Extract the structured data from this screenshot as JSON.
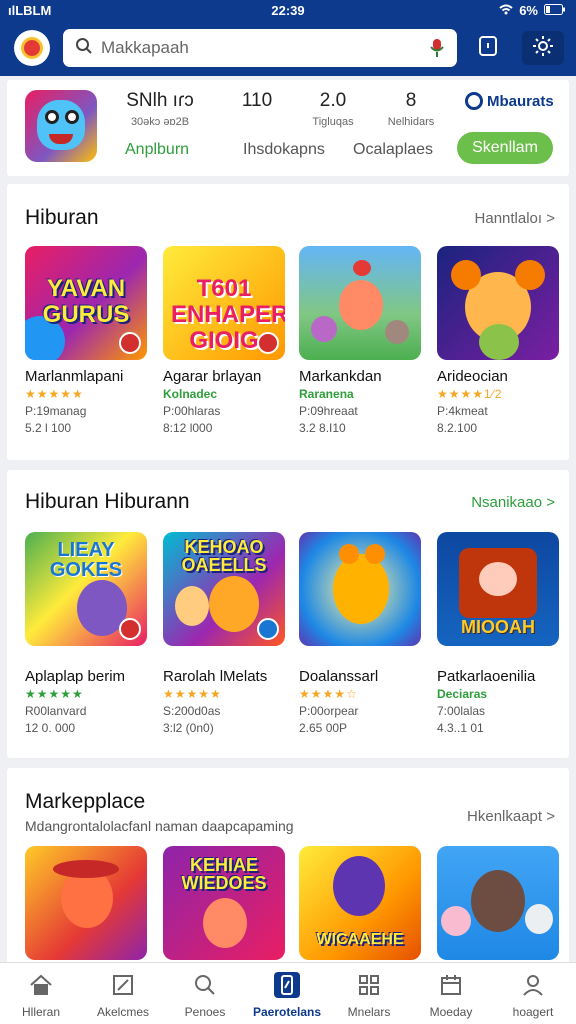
{
  "status_bar": {
    "carrier": "ılLBLM",
    "time": "22:39",
    "battery": "6%"
  },
  "header": {
    "search_placeholder": "Makkapaah",
    "icons": [
      "app-logo",
      "search-icon",
      "mic-icon",
      "save-icon",
      "settings-icon"
    ]
  },
  "top_card": {
    "stats": [
      {
        "value": "SNlh ıɾɔ",
        "label": "30əkɔ əɒ2B"
      },
      {
        "value": "110",
        "label": ""
      },
      {
        "value": "2.0",
        "label": "Tigluqas"
      },
      {
        "value": "8",
        "label": "Nelhidars"
      }
    ],
    "brand": "Mbaurats",
    "links": [
      "Anplburn",
      "Ihsdokapns",
      "Ocalaplaes"
    ],
    "cta": "Skenllam"
  },
  "sections": [
    {
      "title": "Hiburan",
      "subtitle": "",
      "more": "Hanntlaloı >",
      "more_green": false,
      "apps": [
        {
          "name": "Marlanmlapani",
          "art": "YAVAN GURUS",
          "rating": "★★★★★",
          "stat1": "P:19manag",
          "stat2": "5.2 l 100"
        },
        {
          "name": "Agarar brlayan",
          "art": "T601 ENHAPER GIOIG",
          "rating": "Kolnadec",
          "stat1": "P:00hlaras",
          "stat2": "8:12 l000"
        },
        {
          "name": "Markankdan",
          "art": "",
          "rating": "Raranena",
          "stat1": "P:09hreaat",
          "stat2": "3.2 8.I10"
        },
        {
          "name": "Arideocian",
          "art": "",
          "rating": "★★★★1⁄2",
          "stat1": "P:4kmeat",
          "stat2": "8.2.100"
        }
      ]
    },
    {
      "title": "Hiburan Hiburann",
      "subtitle": "",
      "more": "Nsanikaao >",
      "more_green": true,
      "apps": [
        {
          "name": "Aplaplap berim",
          "art": "LIEAY GOKES",
          "rating": "★★★★★",
          "stat1": "R00lanvard",
          "stat2": "12 0. 000"
        },
        {
          "name": "Rarolah lMelats",
          "art": "KEHOAO OAEELLS",
          "rating": "★★★★★",
          "stat1": "S:200d0as",
          "stat2": "3:l2 (0n0)"
        },
        {
          "name": "Doalanssarl",
          "art": "",
          "rating": "★★★★☆",
          "stat1": "P:00orpear",
          "stat2": "2.65 00P"
        },
        {
          "name": "Patkarlaoenilia",
          "art": "MIOOAH",
          "rating": "Deciaras",
          "stat1": "7:00lalas",
          "stat2": "4.3..1 01"
        }
      ]
    },
    {
      "title": "Markepplace",
      "subtitle": "Mdangrontalolacfanl naman daapcapaming",
      "more": "Hkenlkaapt >",
      "more_green": false,
      "apps": [
        {
          "name": "",
          "art": "",
          "rating": "",
          "stat1": "",
          "stat2": ""
        },
        {
          "name": "",
          "art": "KEHIAE WIEDOES",
          "rating": "",
          "stat1": "",
          "stat2": ""
        },
        {
          "name": "",
          "art": "WICAAEHE",
          "rating": "",
          "stat1": "",
          "stat2": ""
        },
        {
          "name": "",
          "art": "",
          "rating": "",
          "stat1": "",
          "stat2": ""
        }
      ]
    }
  ],
  "bottom_nav": [
    {
      "label": "Hlleran",
      "icon": "home-icon",
      "active": false
    },
    {
      "label": "Akelcmes",
      "icon": "edit-icon",
      "active": false
    },
    {
      "label": "Penoes",
      "icon": "search-icon",
      "active": false
    },
    {
      "label": "Paerotelans",
      "icon": "phone-icon",
      "active": true
    },
    {
      "label": "Mnelars",
      "icon": "grid-icon",
      "active": false
    },
    {
      "label": "Moeday",
      "icon": "calendar-icon",
      "active": false
    },
    {
      "label": "hoagert",
      "icon": "profile-icon",
      "active": false
    }
  ],
  "colors": {
    "primary": "#0d3a8c",
    "accent_green": "#2e9e3b",
    "cta_green": "#6cbf4a",
    "star": "#f5a623"
  }
}
